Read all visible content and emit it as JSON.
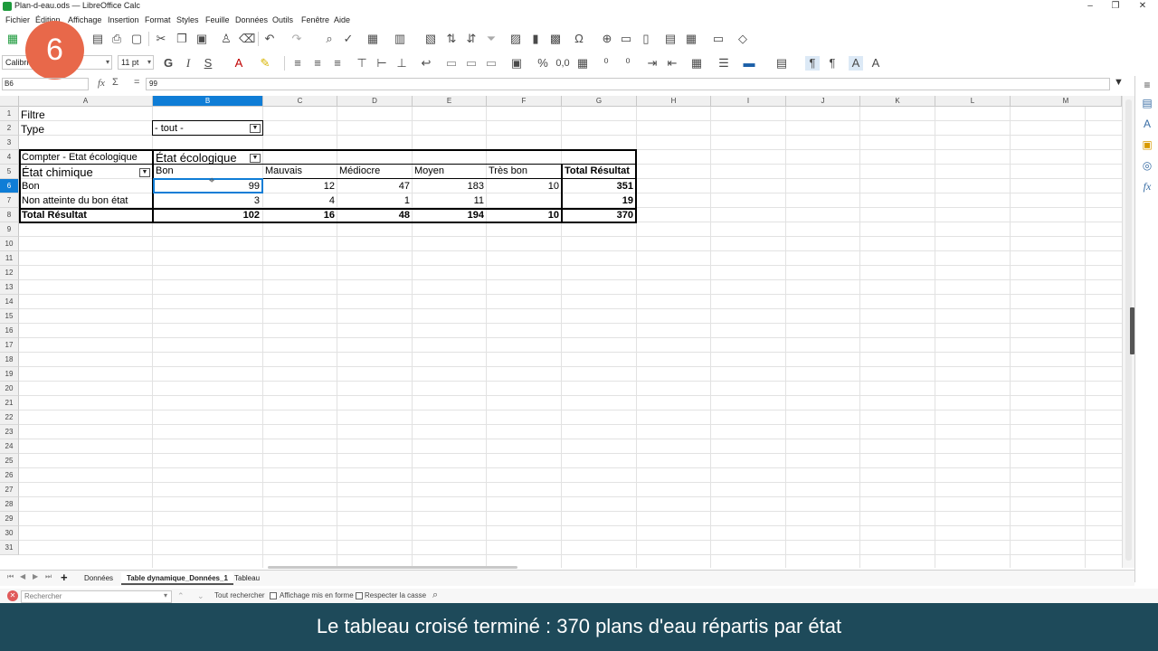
{
  "window": {
    "title": "Plan-d-eau.ods — LibreOffice Calc",
    "minimize": "–",
    "maximize": "❐",
    "close": "✕"
  },
  "menu": [
    "Fichier",
    "Édition",
    "Affichage",
    "Insertion",
    "Format",
    "Styles",
    "Feuille",
    "Données",
    "Outils",
    "Fenêtre",
    "Aide"
  ],
  "step_badge": "6",
  "format_toolbar": {
    "font_name": "Calibri",
    "font_size": "11 pt",
    "bold": "G",
    "italic": "I",
    "underline": "S",
    "percent": "%",
    "number": "0,0"
  },
  "formula_bar": {
    "name_box": "B6",
    "fx": "fx",
    "sigma": "Σ",
    "equals": "=",
    "content": "99"
  },
  "columns": [
    "A",
    "B",
    "C",
    "D",
    "E",
    "F",
    "G",
    "H",
    "I",
    "J",
    "K",
    "L",
    "M"
  ],
  "selected_column": "B",
  "rows": [
    "1",
    "2",
    "3",
    "4",
    "5",
    "6",
    "7",
    "8",
    "9",
    "10",
    "11",
    "12",
    "13",
    "14",
    "15",
    "16",
    "17",
    "18",
    "19",
    "20",
    "21",
    "22",
    "23",
    "24",
    "25",
    "26",
    "27",
    "28",
    "29",
    "30",
    "31"
  ],
  "selected_row": "6",
  "sheet": {
    "filter_label": "Filtre",
    "type_label": "Type",
    "type_value": "- tout -",
    "data_field": "Compter - Etat écologique",
    "column_field": "État écologique",
    "row_field": "État chimique",
    "col_headers": [
      "Bon",
      "Mauvais",
      "Médiocre",
      "Moyen",
      "Très bon",
      "Total Résultat"
    ],
    "rows": [
      {
        "label": "Bon",
        "values": [
          "99",
          "12",
          "47",
          "183",
          "10",
          "351"
        ]
      },
      {
        "label": "Non atteinte du bon état",
        "values": [
          "3",
          "4",
          "1",
          "11",
          "",
          "19"
        ]
      },
      {
        "label": "Total Résultat",
        "values": [
          "102",
          "16",
          "48",
          "194",
          "10",
          "370"
        ]
      }
    ]
  },
  "sheet_tabs": [
    "Données",
    "Table dynamique_Données_1",
    "Tableau"
  ],
  "active_tab": "Table dynamique_Données_1",
  "find_bar": {
    "placeholder": "Rechercher",
    "find_all": "Tout rechercher",
    "formatted_display": "Affichage mis en forme",
    "match_case": "Respecter la casse"
  },
  "caption": "Le tableau croisé terminé : 370 plans d'eau répartis par état",
  "colors": {
    "selection": "#0f7dd6",
    "badge": "#e8684a",
    "caption_bg": "#1e4a5a"
  }
}
